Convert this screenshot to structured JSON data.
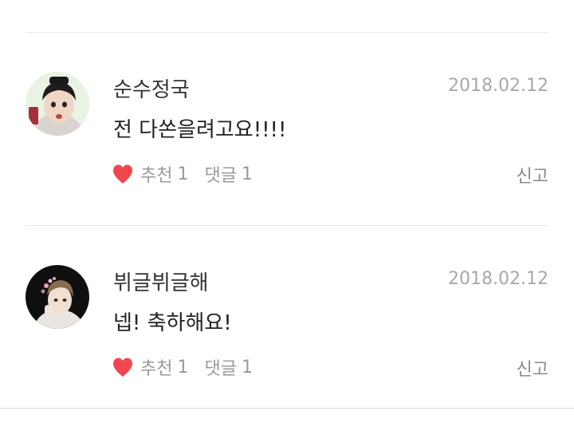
{
  "comments": [
    {
      "username": "순수정국",
      "date": "2018.02.12",
      "text": "전 다쏜을려고요!!!!",
      "like_label": "추천",
      "like_count": "1",
      "reply_label": "댓글",
      "reply_count": "1",
      "report_label": "신고",
      "avatar_icon": "user-avatar",
      "heart_color": "#f0474f"
    },
    {
      "username": "뷔글뷔글해",
      "date": "2018.02.12",
      "text": "넵! 축하해요!",
      "like_label": "추천",
      "like_count": "1",
      "reply_label": "댓글",
      "reply_count": "1",
      "report_label": "신고",
      "avatar_icon": "user-avatar",
      "heart_color": "#f0474f"
    }
  ]
}
